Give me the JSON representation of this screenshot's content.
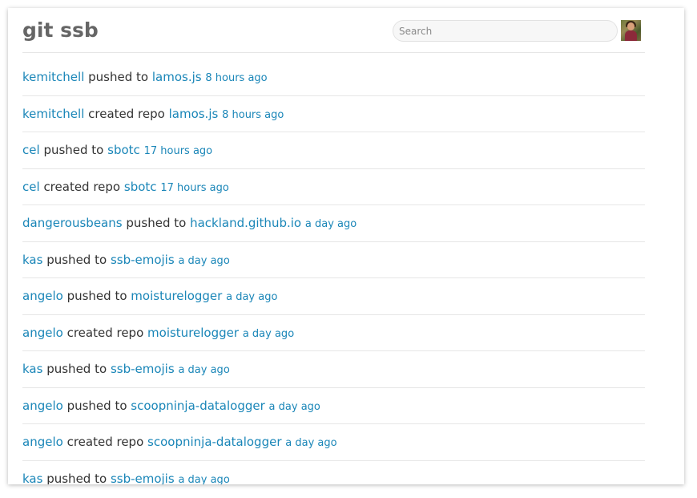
{
  "header": {
    "title": "git ssb",
    "search_placeholder": "Search",
    "search_value": ""
  },
  "colors": {
    "link": "#1a86b8",
    "text": "#333333",
    "title": "#666666",
    "divider": "#e6e6e6"
  },
  "feed": [
    {
      "user": "kemitchell",
      "action": "pushed to",
      "repo": "lamos.js",
      "time": "8 hours ago"
    },
    {
      "user": "kemitchell",
      "action": "created repo",
      "repo": "lamos.js",
      "time": "8 hours ago"
    },
    {
      "user": "cel",
      "action": "pushed to",
      "repo": "sbotc",
      "time": "17 hours ago"
    },
    {
      "user": "cel",
      "action": "created repo",
      "repo": "sbotc",
      "time": "17 hours ago"
    },
    {
      "user": "dangerousbeans",
      "action": "pushed to",
      "repo": "hackland.github.io",
      "time": "a day ago"
    },
    {
      "user": "kas",
      "action": "pushed to",
      "repo": "ssb-emojis",
      "time": "a day ago"
    },
    {
      "user": "angelo",
      "action": "pushed to",
      "repo": "moisturelogger",
      "time": "a day ago"
    },
    {
      "user": "angelo",
      "action": "created repo",
      "repo": "moisturelogger",
      "time": "a day ago"
    },
    {
      "user": "kas",
      "action": "pushed to",
      "repo": "ssb-emojis",
      "time": "a day ago"
    },
    {
      "user": "angelo",
      "action": "pushed to",
      "repo": "scoopninja-datalogger",
      "time": "a day ago"
    },
    {
      "user": "angelo",
      "action": "created repo",
      "repo": "scoopninja-datalogger",
      "time": "a day ago"
    },
    {
      "user": "kas",
      "action": "pushed to",
      "repo": "ssb-emojis",
      "time": "a day ago"
    }
  ]
}
